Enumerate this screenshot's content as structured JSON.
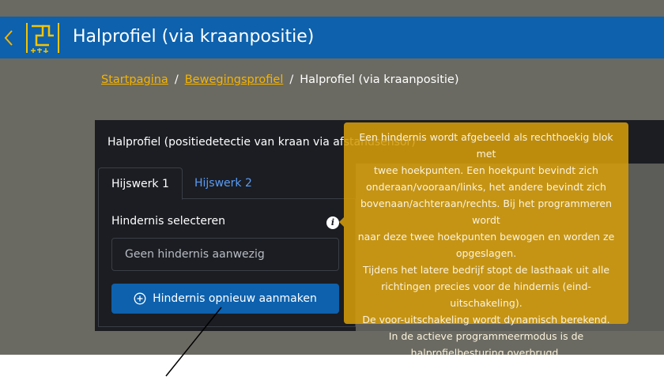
{
  "header": {
    "back_icon": "chevron-left-icon",
    "logo_icon": "crane-profile-icon",
    "title": "Halprofiel (via kraanpositie)"
  },
  "breadcrumb": {
    "items": [
      "Startpagina",
      "Bewegingsprofiel"
    ],
    "current": "Halprofiel (via kraanpositie)",
    "separator": "/"
  },
  "panel": {
    "heading": "Halprofiel (positiedetectie van kraan via afstandsensor)",
    "tabs": [
      {
        "label": "Hijswerk 1",
        "active": true
      },
      {
        "label": "Hijswerk 2",
        "active": false
      }
    ],
    "field_label": "Hindernis selecteren",
    "info_icon": "info-icon",
    "info_glyph": "i",
    "select_value": "Geen hindernis aanwezig",
    "button_label": "Hindernis opnieuw aanmaken",
    "button_icon": "plus-circle-icon"
  },
  "tooltip": {
    "lines": [
      "Een hindernis wordt afgebeeld als rechthoekig blok met",
      "twee hoekpunten. Een hoekpunt bevindt zich",
      "onderaan/vooraan/links, het andere bevindt zich",
      "bovenaan/achteraan/rechts. Bij het programmeren wordt",
      "naar deze twee hoekpunten bewogen en worden ze",
      "opgeslagen.",
      "Tijdens het latere bedrijf stopt de lasthaak uit alle",
      "richtingen precies voor de hindernis (eind-uitschakeling).",
      "De voor-uitschakeling wordt dynamisch berekend.",
      "In de actieve programmeermodus is de",
      "halprofielbesturing overbrugd."
    ]
  },
  "colors": {
    "header_bg": "#0d61ad",
    "accent_link": "#f5b400",
    "tab_inactive": "#5b9cf6",
    "tooltip_bg": "#d49c0a",
    "panel_bg": "#1b1d22",
    "screen_bg": "#6b6a62"
  }
}
